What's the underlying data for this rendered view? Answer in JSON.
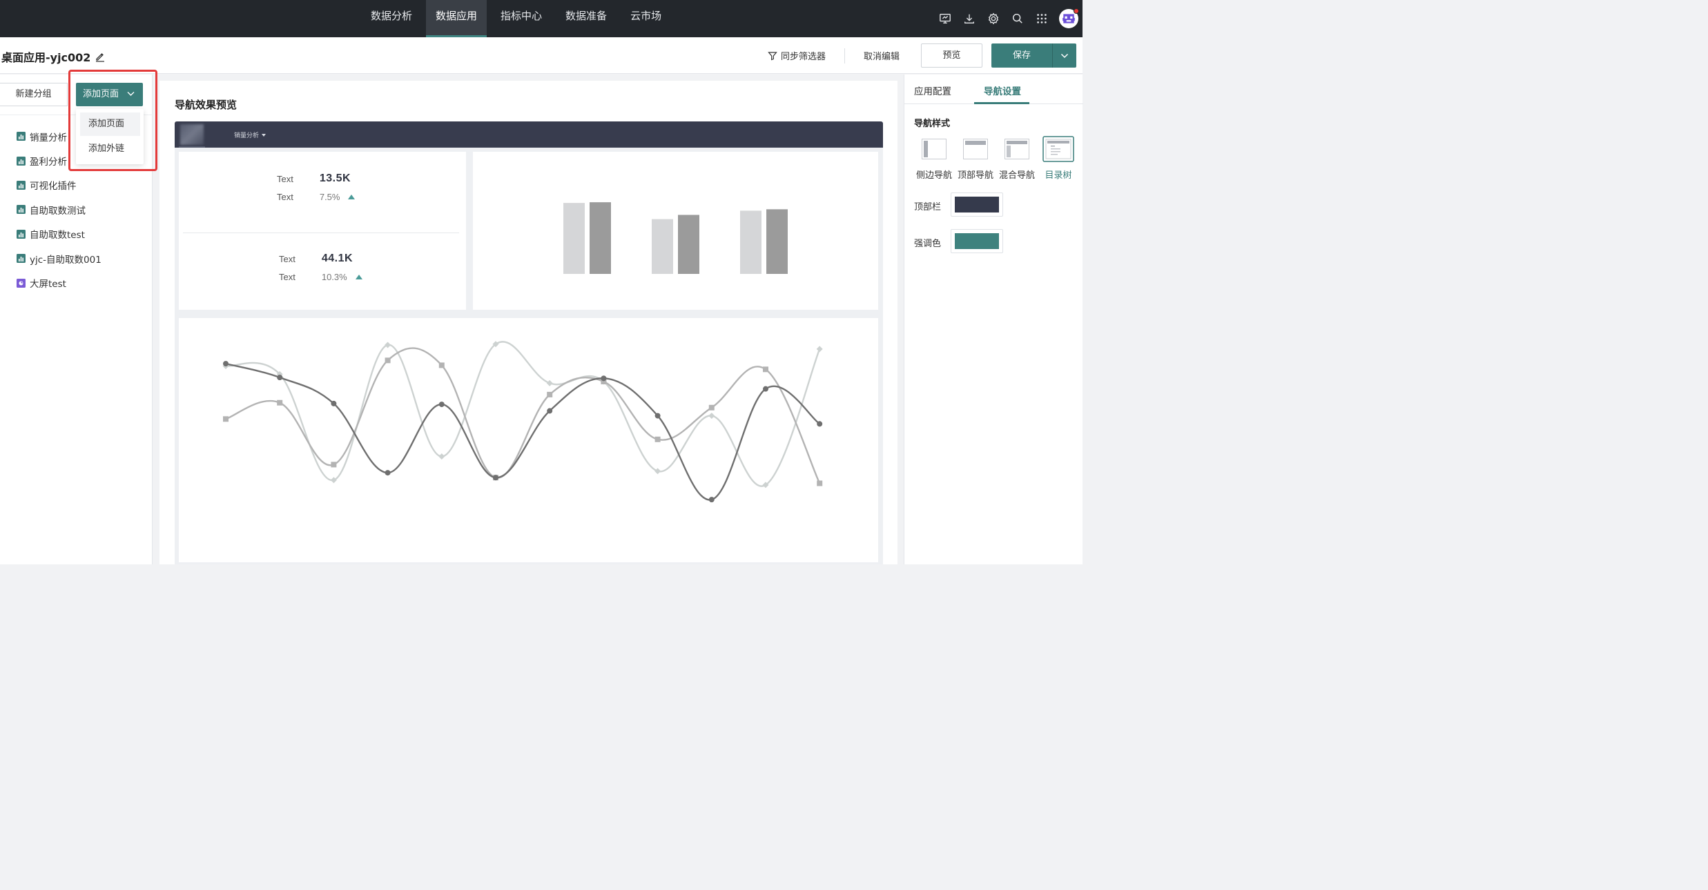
{
  "topnav": {
    "items": [
      {
        "label": "数据分析"
      },
      {
        "label": "数据应用"
      },
      {
        "label": "指标中心"
      },
      {
        "label": "数据准备"
      },
      {
        "label": "云市场"
      }
    ],
    "active_index": 1,
    "tool_icons": [
      "screen-icon",
      "download-icon",
      "gear-icon",
      "search-icon",
      "apps-grid-icon",
      "avatar"
    ]
  },
  "toolbar": {
    "app_title": "桌面应用-yjc002",
    "sync_filter_label": "同步筛选器",
    "cancel_edit_label": "取消编辑",
    "preview_label": "预览",
    "save_label": "保存"
  },
  "sidebar": {
    "new_group_label": "新建分组",
    "add_page_label": "添加页面",
    "pages": [
      {
        "label": "销量分析",
        "icon": "bar-chart-icon"
      },
      {
        "label": "盈利分析",
        "icon": "bar-chart-icon"
      },
      {
        "label": "可视化插件",
        "icon": "bar-chart-icon"
      },
      {
        "label": "自助取数测试",
        "icon": "bar-chart-icon"
      },
      {
        "label": "自助取数test",
        "icon": "bar-chart-icon"
      },
      {
        "label": "yjc-自助取数001",
        "icon": "bar-chart-icon"
      },
      {
        "label": "大屏test",
        "icon": "screen-app-icon"
      }
    ],
    "dropdown": {
      "items": [
        {
          "label": "添加页面"
        },
        {
          "label": "添加外链"
        }
      ]
    }
  },
  "canvas": {
    "title": "导航效果预览",
    "preview_nav_label": "销量分析",
    "kpis": [
      {
        "label1": "Text",
        "value": "13.5K",
        "label2": "Text",
        "pct": "7.5%"
      },
      {
        "label1": "Text",
        "value": "44.1K",
        "label2": "Text",
        "pct": "10.3%"
      }
    ]
  },
  "chart_data": [
    {
      "type": "bar",
      "categories": [
        "",
        "",
        ""
      ],
      "series": [
        {
          "values": [
            101,
            78,
            90
          ],
          "color": "#d5d6d8"
        },
        {
          "values": [
            102,
            84,
            92
          ],
          "color": "#9b9b9b"
        }
      ],
      "ylim": [
        0,
        110
      ],
      "grid": false
    },
    {
      "type": "line",
      "x": [
        0,
        1,
        2,
        3,
        4,
        5,
        6,
        7,
        8,
        9,
        10,
        11,
        12,
        13,
        14
      ],
      "series": [
        {
          "values": [
            244,
            227,
            195,
            110,
            194,
            104,
            186,
            226,
            180,
            77,
            213,
            170
          ],
          "x": [
            0,
            1,
            2,
            3,
            4,
            5,
            6,
            7,
            8,
            9,
            10,
            11
          ],
          "color": "#6f6f6f",
          "marker": "circle"
        },
        {
          "values": [
            176,
            196,
            120,
            248,
            242,
            104,
            206,
            222,
            151,
            190,
            237,
            97
          ],
          "x": [
            0,
            1,
            2,
            3,
            4,
            5,
            6,
            7,
            8,
            9,
            10,
            11
          ],
          "color": "#b3b3b3",
          "marker": "square"
        },
        {
          "values": [
            241,
            231,
            101,
            267,
            130,
            268,
            220,
            222,
            112,
            180,
            95,
            262
          ],
          "x": [
            0,
            1,
            2,
            3,
            4,
            5,
            6,
            7,
            8,
            9,
            10,
            11
          ],
          "color": "#cdd2d1",
          "marker": "diamond"
        }
      ],
      "ylim": [
        0,
        300
      ],
      "grid": false
    }
  ],
  "rpanel": {
    "tabs": [
      {
        "label": "应用配置"
      },
      {
        "label": "导航设置"
      }
    ],
    "active_tab": 1,
    "nav_style_title": "导航样式",
    "nav_styles": [
      {
        "label": "侧边导航"
      },
      {
        "label": "顶部导航"
      },
      {
        "label": "混合导航"
      },
      {
        "label": "目录树"
      }
    ],
    "active_style": 3,
    "topbar_label": "顶部栏",
    "topbar_color": "#353a4c",
    "accent_label": "强调色",
    "accent_color": "#3e827e"
  }
}
